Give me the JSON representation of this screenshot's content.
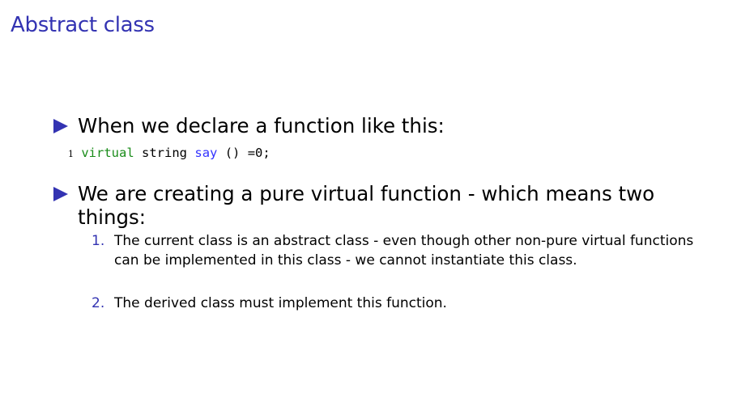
{
  "title": "Abstract class",
  "bullets": [
    {
      "text": "When we declare a function like this:"
    },
    {
      "text": "We are creating a pure virtual function - which means two things:"
    }
  ],
  "code": {
    "line_number": "1",
    "keyword": "virtual",
    "type": "string",
    "name": "say",
    "rest": "() =0;"
  },
  "sublist": [
    {
      "number": "1.",
      "text": "The current class is an abstract class - even though other non-pure virtual functions can be implemented in this class - we cannot instantiate this class."
    },
    {
      "number": "2.",
      "text": "The derived class must implement this function."
    }
  ],
  "colors": {
    "accent": "#3333b2",
    "keyword": "#1a8c1a",
    "function": "#3333ff"
  }
}
